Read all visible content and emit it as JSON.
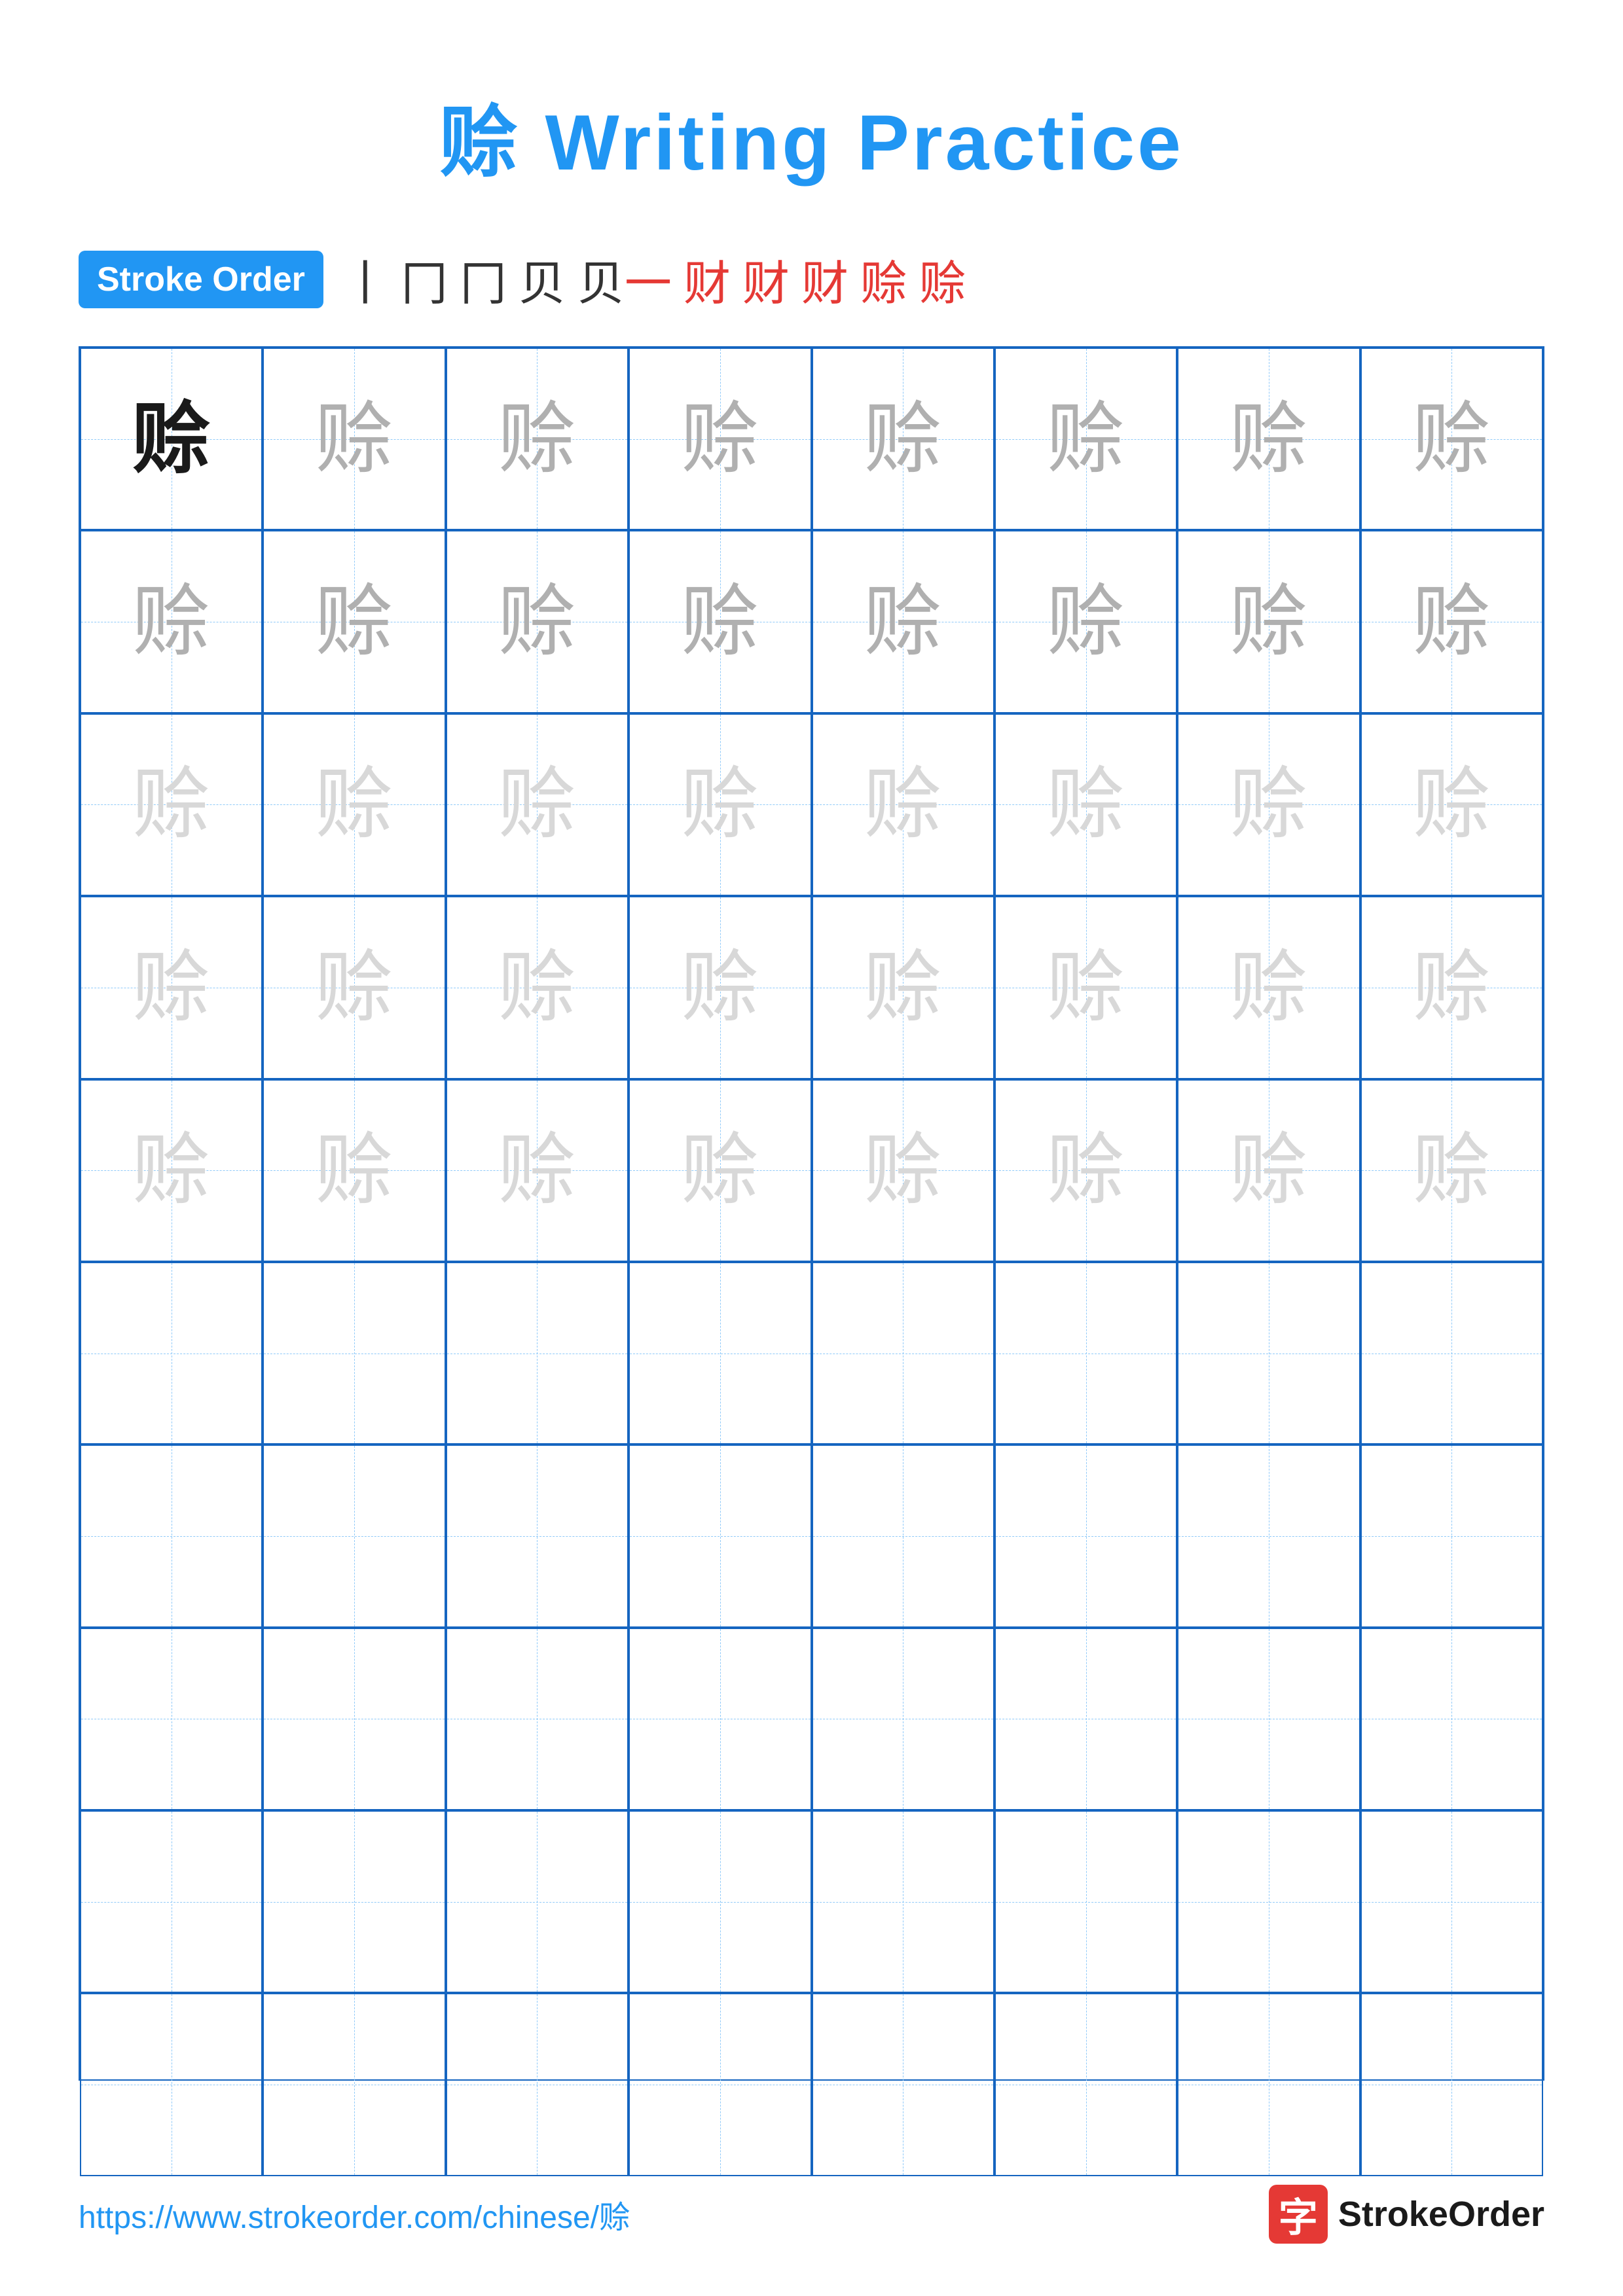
{
  "title": "赊 Writing Practice",
  "stroke_order": {
    "badge_label": "Stroke Order",
    "strokes": [
      "丨",
      "冂",
      "冂",
      "贝",
      "贝一",
      "财",
      "财",
      "财",
      "赊",
      "赊"
    ]
  },
  "character": "赊",
  "grid": {
    "rows": 10,
    "cols": 8
  },
  "footer": {
    "url": "https://www.strokeorder.com/chinese/赊",
    "logo_char": "字",
    "logo_text": "StrokeOrder"
  },
  "colors": {
    "blue_accent": "#2196F3",
    "dark_blue": "#1565C0",
    "red": "#e53935",
    "char_dark": "#1a1a1a",
    "char_medium": "#b0b0b0",
    "char_light": "#d8d8d8"
  }
}
